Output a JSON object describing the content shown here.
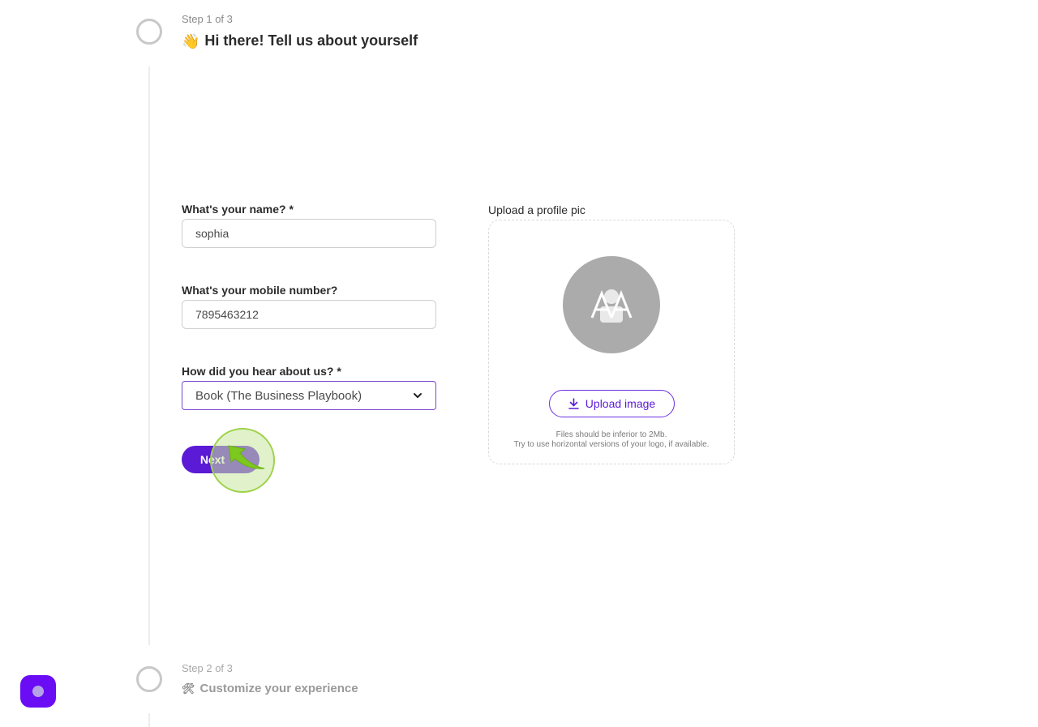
{
  "steps": [
    {
      "label": "Step 1 of 3",
      "icon": "waving-hand-icon",
      "emoji": "👋",
      "title": "Hi there! Tell us about yourself"
    },
    {
      "label": "Step 2 of 3",
      "icon": "tools-icon",
      "emoji": "🛠",
      "title": "Customize your experience"
    }
  ],
  "form": {
    "name": {
      "label": "What's your name? *",
      "value": "sophia"
    },
    "mobile": {
      "label": "What's your mobile number?",
      "value": "7895463212"
    },
    "source": {
      "label": "How did you hear about us? *",
      "selected": "Book (The Business Playbook)"
    },
    "next_label": "Next"
  },
  "upload": {
    "label": "Upload a profile pic",
    "button_label": "Upload image",
    "hint_line1": "Files should be inferior to 2Mb.",
    "hint_line2": "Try to use horizontal versions of your logo, if available."
  },
  "colors": {
    "accent": "#5b1ad6",
    "chat_fab": "#6a0df5",
    "click_highlight": "#9ed24a"
  }
}
